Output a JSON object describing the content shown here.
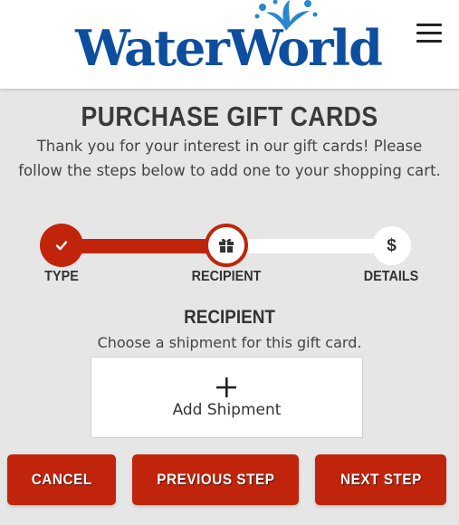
{
  "header": {
    "logo_text": "WaterWorld",
    "brand_color": "#0d4f9e",
    "menu_icon": "hamburger-menu-icon"
  },
  "page": {
    "title": "PURCHASE GIFT CARDS",
    "intro": "Thank you for your interest in our gift cards! Please follow the steps below to add one to your shopping cart."
  },
  "steps": [
    {
      "label": "TYPE",
      "icon": "check-icon",
      "state": "complete"
    },
    {
      "label": "RECIPIENT",
      "icon": "gift-icon",
      "state": "current"
    },
    {
      "label": "DETAILS",
      "icon": "dollar-icon",
      "glyph": "$",
      "state": "upcoming"
    }
  ],
  "progress": {
    "fraction": 0.5
  },
  "recipient": {
    "heading": "RECIPIENT",
    "subtext": "Choose a shipment for this gift card.",
    "add_shipment_label": "Add Shipment",
    "add_icon": "plus-icon"
  },
  "buttons": {
    "cancel": "CANCEL",
    "previous": "PREVIOUS STEP",
    "next": "NEXT STEP"
  },
  "colors": {
    "accent": "#c0250c",
    "background": "#e6e6e6",
    "text": "#333333"
  }
}
